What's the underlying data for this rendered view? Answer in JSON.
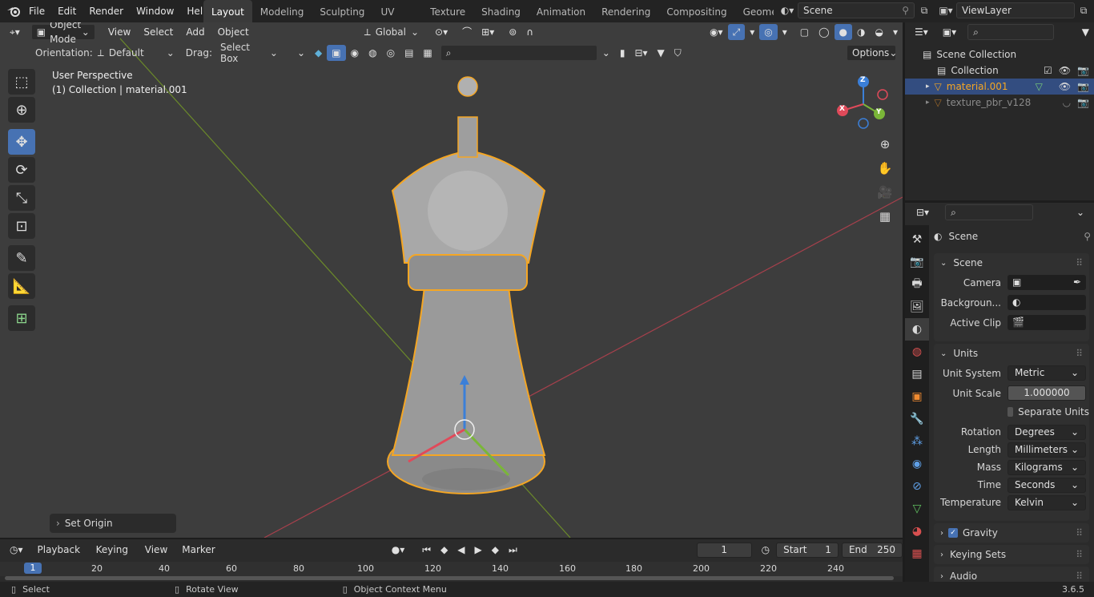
{
  "app": {
    "logo": "blender-logo",
    "version": "3.6.5"
  },
  "menu": [
    "File",
    "Edit",
    "Render",
    "Window",
    "Help"
  ],
  "workspaces": [
    "Layout",
    "Modeling",
    "Sculpting",
    "UV Editing",
    "Texture Paint",
    "Shading",
    "Animation",
    "Rendering",
    "Compositing",
    "Geometry Noc"
  ],
  "active_workspace": "Layout",
  "scene_name": "Scene",
  "view_layer": "ViewLayer",
  "viewport": {
    "mode": "Object Mode",
    "menus": [
      "View",
      "Select",
      "Add",
      "Object"
    ],
    "transform_space": "Global",
    "orientation_label": "Orientation:",
    "orientation_value": "Default",
    "drag_label": "Drag:",
    "drag_value": "Select Box",
    "options": "Options",
    "overlay_title": "User Perspective",
    "overlay_subtitle": "(1) Collection | material.001",
    "last_operator": "Set Origin",
    "gizmo": {
      "x": "X",
      "y": "Y",
      "z": "Z"
    }
  },
  "outliner": {
    "root": "Scene Collection",
    "items": [
      {
        "label": "Collection",
        "icon": "collection-icon"
      },
      {
        "label": "material.001",
        "icon": "mesh-icon",
        "selected": true
      },
      {
        "label": "texture_pbr_v128",
        "icon": "mesh-icon",
        "selected": false
      }
    ]
  },
  "properties": {
    "context": "Scene",
    "scene_panel": {
      "title": "Scene",
      "camera_label": "Camera",
      "background_label": "Backgroun...",
      "active_clip_label": "Active Clip"
    },
    "units_panel": {
      "title": "Units",
      "unit_system_label": "Unit System",
      "unit_system": "Metric",
      "unit_scale_label": "Unit Scale",
      "unit_scale": "1.000000",
      "separate_units": "Separate Units",
      "rotation_label": "Rotation",
      "rotation": "Degrees",
      "length_label": "Length",
      "length": "Millimeters",
      "mass_label": "Mass",
      "mass": "Kilograms",
      "time_label": "Time",
      "time": "Seconds",
      "temperature_label": "Temperature",
      "temperature": "Kelvin"
    },
    "gravity": "Gravity",
    "keying_sets": "Keying Sets",
    "audio": "Audio"
  },
  "timeline": {
    "menus": [
      "Playback",
      "Keying",
      "View",
      "Marker"
    ],
    "current_frame": "1",
    "start_label": "Start",
    "start": "1",
    "end_label": "End",
    "end": "250",
    "ticks": [
      "1",
      "20",
      "40",
      "60",
      "80",
      "100",
      "120",
      "140",
      "160",
      "180",
      "200",
      "220",
      "240"
    ]
  },
  "statusbar": {
    "left": "Select",
    "middle": "Rotate View",
    "right": "Object Context Menu"
  },
  "colors": {
    "accent": "#4772b3",
    "selection_orange": "#f5a623",
    "x_axis": "#e04a5a",
    "y_axis": "#7ab638",
    "z_axis": "#3b7fd8"
  }
}
